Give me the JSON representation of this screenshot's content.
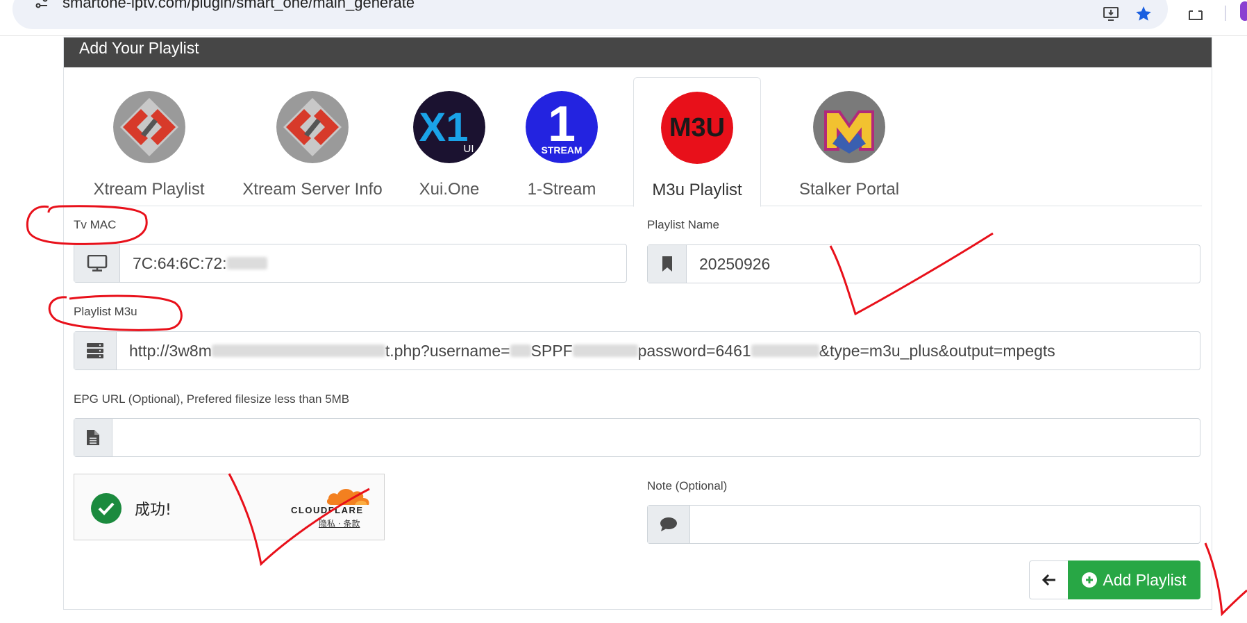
{
  "browser": {
    "url": "smartone-iptv.com/plugin/smart_one/main_generate",
    "site_info_icon": "tune-icon",
    "icons": [
      "install-icon",
      "bookmark-star-icon",
      "extensions-icon"
    ]
  },
  "card": {
    "header": "Add Your Playlist"
  },
  "tabs": [
    {
      "label": "Xtream Playlist",
      "logo": "xtream-logo",
      "active": false
    },
    {
      "label": "Xtream Server Info",
      "logo": "xtream-logo",
      "active": false
    },
    {
      "label": "Xui.One",
      "logo": "xui-one-logo",
      "active": false
    },
    {
      "label": "1-Stream",
      "logo": "one-stream-logo",
      "active": false
    },
    {
      "label": "M3u Playlist",
      "logo": "m3u-logo",
      "active": true
    },
    {
      "label": "Stalker Portal",
      "logo": "stalker-portal-logo",
      "active": false
    }
  ],
  "logos": {
    "xui_text": "X1",
    "xui_sub": "UI",
    "stream_num": "1",
    "stream_text": "STREAM",
    "m3u_text": "M3U"
  },
  "form": {
    "tv_mac": {
      "label": "Tv MAC",
      "value": "7C:64:6C:72:",
      "icon": "monitor-icon"
    },
    "playlist_name": {
      "label": "Playlist Name",
      "value": "20250926",
      "icon": "bookmark-icon"
    },
    "playlist_m3u": {
      "label": "Playlist M3u",
      "value_parts": [
        "http://3w8m",
        "t.php?username=",
        "SPPF",
        "password=6461",
        "&type=m3u_plus&output=mpegts"
      ],
      "icon": "server-icon"
    },
    "epg_url": {
      "label": "EPG URL (Optional), Prefered filesize less than 5MB",
      "value": "",
      "icon": "file-icon"
    },
    "note": {
      "label": "Note (Optional)",
      "value": "",
      "icon": "comment-icon"
    }
  },
  "captcha": {
    "status": "成功!",
    "provider": "CLOUDFLARE",
    "links": "隐私 · 条款"
  },
  "buttons": {
    "add_playlist": "Add Playlist",
    "back_icon": "arrow-left-icon"
  },
  "colors": {
    "header_bg": "#464646",
    "add_button": "#28a745",
    "m3u_red": "#e8101a",
    "stream_blue": "#2323e0",
    "annotation_red": "#e8101a"
  }
}
